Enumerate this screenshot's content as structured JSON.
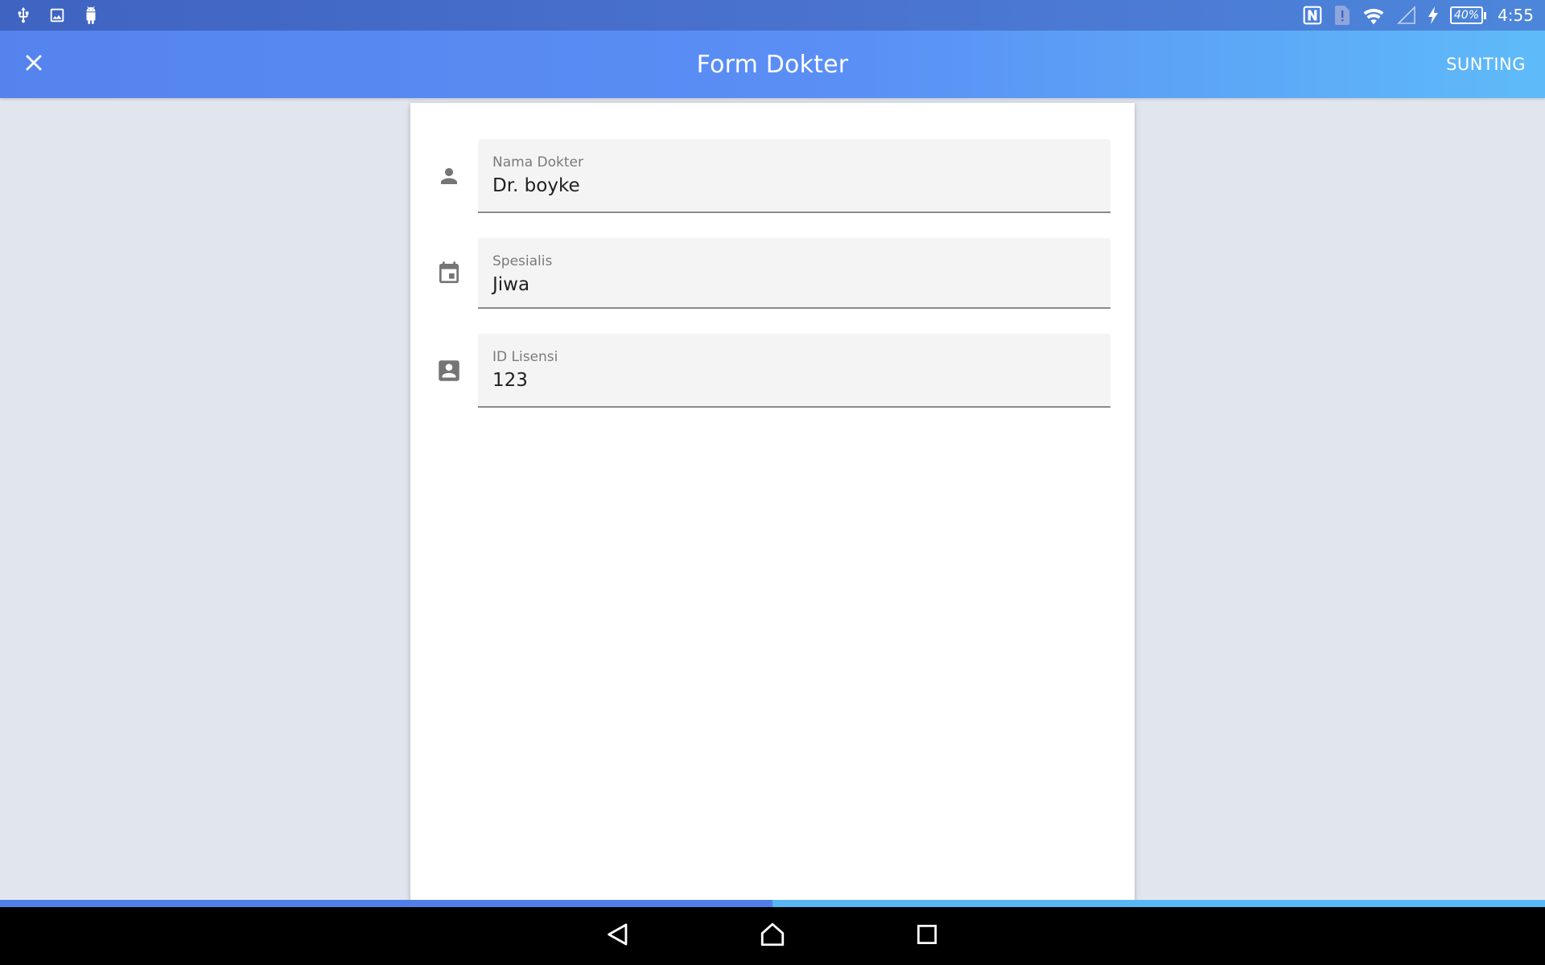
{
  "status_bar": {
    "left_icons": [
      "usb-icon",
      "image-icon",
      "android-debug-icon"
    ],
    "right_icons": [
      "nfc-icon",
      "sim-alert-icon",
      "wifi-icon",
      "signal-icon",
      "charging-icon"
    ],
    "battery": "40%",
    "time": "4:55"
  },
  "app_bar": {
    "close_icon": "close-icon",
    "title": "Form Dokter",
    "action_label": "SUNTING"
  },
  "form": {
    "fields": [
      {
        "icon": "person-icon",
        "label": "Nama Dokter",
        "value": "Dr. boyke"
      },
      {
        "icon": "calendar-icon",
        "label": "Spesialis",
        "value": "Jiwa"
      },
      {
        "icon": "contact-card-icon",
        "label": "ID Lisensi",
        "value": "123"
      }
    ]
  },
  "progress": {
    "fraction": 0.5
  },
  "nav_bar": {
    "buttons": [
      "back-icon",
      "home-icon",
      "recents-icon"
    ]
  },
  "colors": {
    "status_bar": "#3f63c1",
    "app_bar_start": "#5583ee",
    "app_bar_end": "#5ebbf8",
    "background": "#e1e6ee",
    "field_bg": "#f4f4f4",
    "icon_gray": "#757575"
  }
}
